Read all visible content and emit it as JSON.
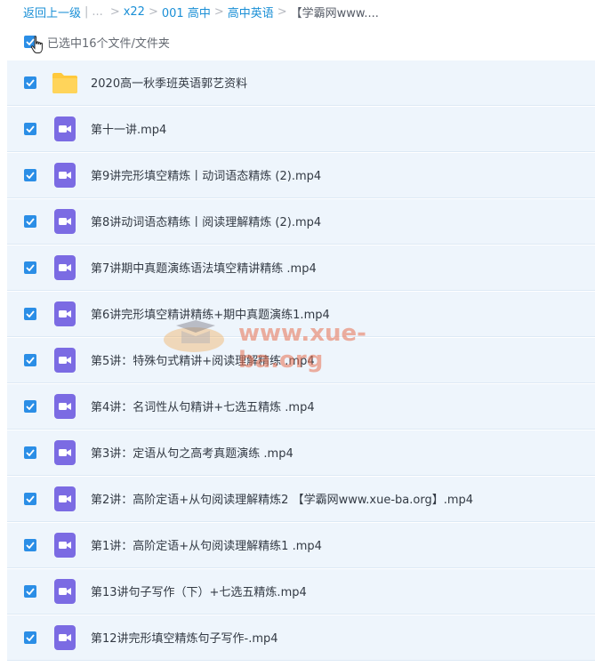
{
  "breadcrumb": {
    "back": "返回上一级",
    "divider": "|",
    "ellipsis": "...",
    "sep": ">",
    "crumbs": [
      "x22",
      "001 高中",
      "高中英语"
    ],
    "current": "【学霸网www...."
  },
  "selection": {
    "label": "已选中16个文件/文件夹"
  },
  "files": [
    {
      "name": "2020高一秋季班英语郭艺资料",
      "icon": "folder-icon"
    },
    {
      "name": "第十一讲.mp4",
      "icon": "video-icon"
    },
    {
      "name": "第9讲完形填空精炼丨动词语态精炼 (2).mp4",
      "icon": "video-icon"
    },
    {
      "name": "第8讲动词语态精练丨阅读理解精炼 (2).mp4",
      "icon": "video-icon"
    },
    {
      "name": "第7讲期中真题演练语法填空精讲精练 .mp4",
      "icon": "video-icon"
    },
    {
      "name": "第6讲完形填空精讲精练+期中真题演练1.mp4",
      "icon": "video-icon"
    },
    {
      "name": "第5讲：特殊句式精讲+阅读理解精练 .mp4",
      "icon": "video-icon"
    },
    {
      "name": "第4讲：名词性从句精讲+七选五精炼 .mp4",
      "icon": "video-icon"
    },
    {
      "name": "第3讲：定语从句之高考真题演练 .mp4",
      "icon": "video-icon"
    },
    {
      "name": "第2讲：高阶定语+从句阅读理解精炼2 【学霸网www.xue-ba.org】.mp4",
      "icon": "video-icon"
    },
    {
      "name": "第1讲：高阶定语+从句阅读理解精练1 .mp4",
      "icon": "video-icon"
    },
    {
      "name": "第13讲句子写作（下）+七选五精炼.mp4",
      "icon": "video-icon"
    },
    {
      "name": "第12讲完形填空精炼句子写作-.mp4",
      "icon": "video-icon"
    }
  ],
  "watermark": {
    "text": "www.xue-ba.org"
  },
  "colors": {
    "accent": "#2b8ee6",
    "link": "#1a8fd6",
    "row_bg": "#eef5fc",
    "video": "#7b6be3",
    "folder": "#ffc93c"
  }
}
